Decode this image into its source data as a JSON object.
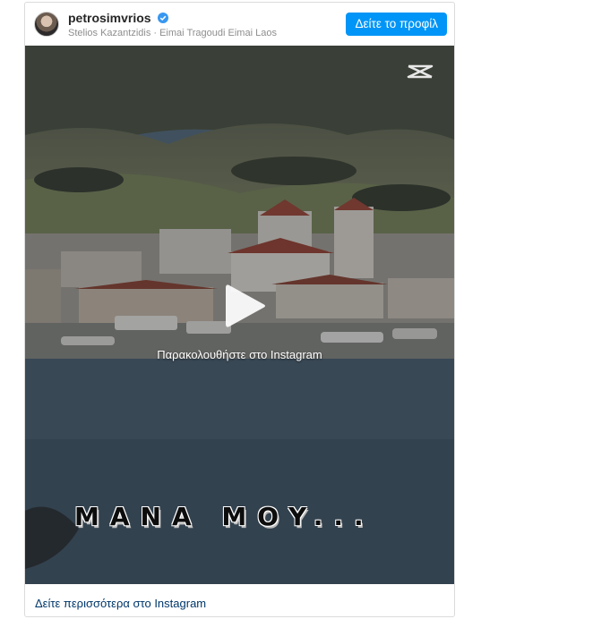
{
  "header": {
    "username": "petrosimvrios",
    "subtitle": "Stelios Kazantzidis · Eimai Tragoudi Eimai Laos",
    "profile_button": "Δείτε το προφίλ"
  },
  "media": {
    "watch_label": "Παρακολουθήστε στο Instagram",
    "caption": "MANA MOY..."
  },
  "footer": {
    "more_link": "Δείτε περισσότερα στο Instagram"
  },
  "colors": {
    "accent": "#0095f6",
    "link": "#00376b",
    "verified": "#3897f0"
  },
  "icons": [
    "verified-badge-icon",
    "play-icon",
    "capcut-logo-icon"
  ]
}
